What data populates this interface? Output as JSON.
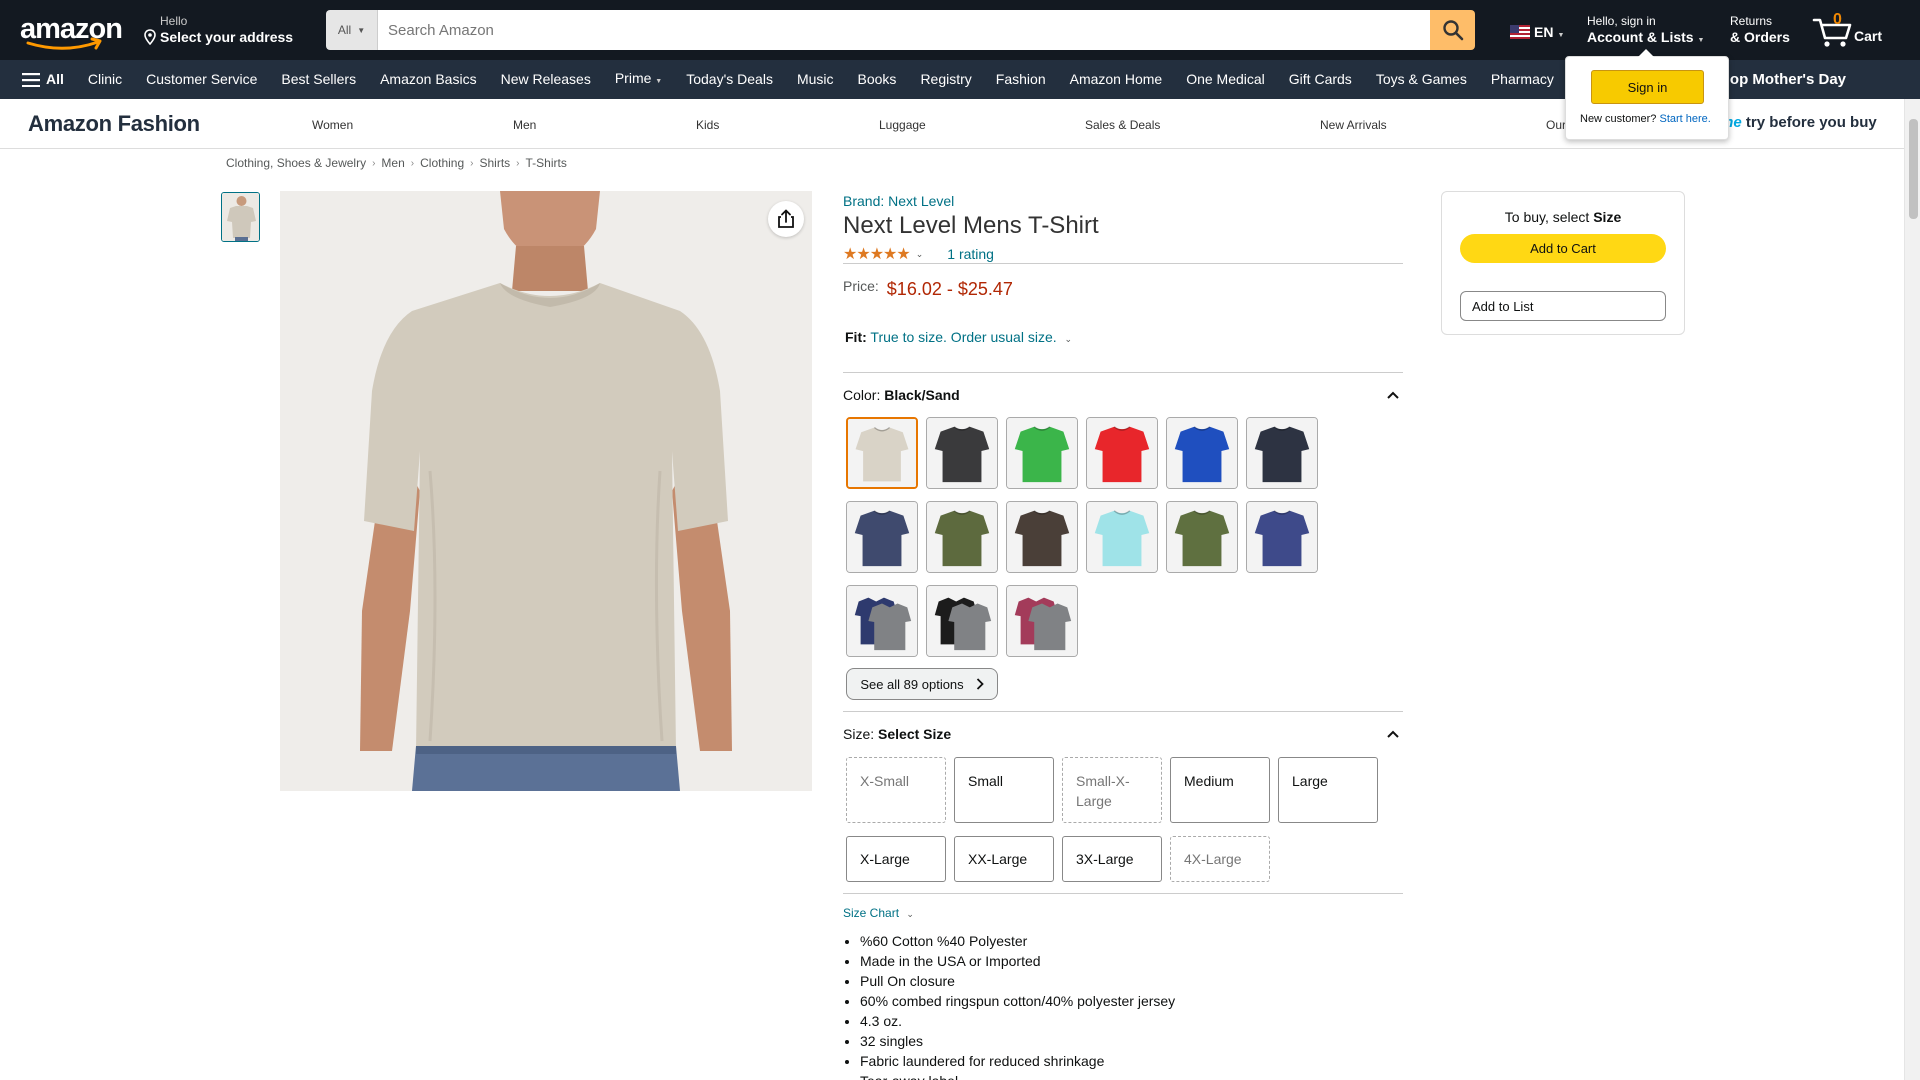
{
  "header": {
    "address_line1": "Hello",
    "address_line2": "Select your address",
    "search_category": "All",
    "search_placeholder": "Search Amazon",
    "language": "EN",
    "account_line1": "Hello, sign in",
    "account_line2": "Account & Lists",
    "returns_line1": "Returns",
    "returns_line2": "& Orders",
    "cart_count": "0",
    "cart_label": "Cart"
  },
  "subnav": {
    "all_label": "All",
    "items": [
      "Clinic",
      "Customer Service",
      "Best Sellers",
      "Amazon Basics",
      "New Releases",
      "Prime",
      "Today's Deals",
      "Music",
      "Books",
      "Registry",
      "Fashion",
      "Amazon Home",
      "One Medical",
      "Gift Cards",
      "Toys & Games",
      "Pharmacy"
    ],
    "promo": "Shop Mother's Day"
  },
  "fashion": {
    "title": "Amazon Fashion",
    "links": [
      "Women",
      "Men",
      "Kids",
      "Luggage",
      "Sales & Deals",
      "New Arrivals",
      "Our"
    ],
    "try_prime": "me",
    "try_rest": "try before you buy"
  },
  "signin_popup": {
    "button": "Sign in",
    "new_customer": "New customer?",
    "start_here": "Start here."
  },
  "breadcrumb": [
    "Clothing, Shoes & Jewelry",
    "Men",
    "Clothing",
    "Shirts",
    "T-Shirts"
  ],
  "product": {
    "brand": "Brand: Next Level",
    "title": "Next Level Mens T-Shirt",
    "stars": "★★★★★",
    "rating_count": "1 rating",
    "rating_value": 5,
    "price_label": "Price:",
    "price_range": "$16.02 - $25.47",
    "fit_label": "Fit:",
    "fit_value": "True to size. Order usual size.",
    "color_label": "Color:",
    "color_value": "Black/Sand",
    "colors": [
      {
        "name": "sand",
        "hex": "#d9d3c7"
      },
      {
        "name": "charcoal",
        "hex": "#3a3a3c"
      },
      {
        "name": "kelly-green",
        "hex": "#3bb54a"
      },
      {
        "name": "red",
        "hex": "#e8262b"
      },
      {
        "name": "royal",
        "hex": "#1f4fbf"
      },
      {
        "name": "dark-navy",
        "hex": "#2d3342"
      },
      {
        "name": "indigo",
        "hex": "#3f4a6e"
      },
      {
        "name": "military-green",
        "hex": "#5d6a3e"
      },
      {
        "name": "dark-brown",
        "hex": "#4a3f38"
      },
      {
        "name": "light-aqua",
        "hex": "#9fe3e8"
      },
      {
        "name": "heather-green",
        "hex": "#5f7040"
      },
      {
        "name": "heather-royal",
        "hex": "#3e4a8a"
      },
      {
        "name": "multi-pack-a",
        "hex": "#2e3a6e"
      },
      {
        "name": "multi-pack-b",
        "hex": "#1c1c1c"
      },
      {
        "name": "multi-pack-c",
        "hex": "#a33b5a"
      }
    ],
    "see_all": "See all 89 options",
    "size_label": "Size:",
    "size_value": "Select Size",
    "sizes": [
      {
        "label": "X-Small",
        "available": false
      },
      {
        "label": "Small",
        "available": true
      },
      {
        "label": "Small-X-Large",
        "available": false
      },
      {
        "label": "Medium",
        "available": true
      },
      {
        "label": "Large",
        "available": true
      },
      {
        "label": "X-Large",
        "available": true
      },
      {
        "label": "XX-Large",
        "available": true
      },
      {
        "label": "3X-Large",
        "available": true
      },
      {
        "label": "4X-Large",
        "available": false
      }
    ],
    "size_chart": "Size Chart",
    "bullets": [
      "%60 Cotton %40 Polyester",
      "Made in the USA or Imported",
      "Pull On closure",
      "60% combed ringspun cotton/40% polyester jersey",
      "4.3 oz.",
      "32 singles",
      "Fabric laundered for reduced shrinkage",
      "Tear-away label"
    ]
  },
  "buybox": {
    "prefix": "To buy, select",
    "emphasis": "Size",
    "add_to_cart": "Add to Cart",
    "add_to_list": "Add to List"
  },
  "colors": {
    "nav_bg": "#131921",
    "subnav_bg": "#232f3e",
    "search_button": "#febd69",
    "price_red": "#B12704",
    "link_teal": "#007185",
    "cart_yellow": "#ffd814",
    "selected_swatch": "#e77600"
  }
}
